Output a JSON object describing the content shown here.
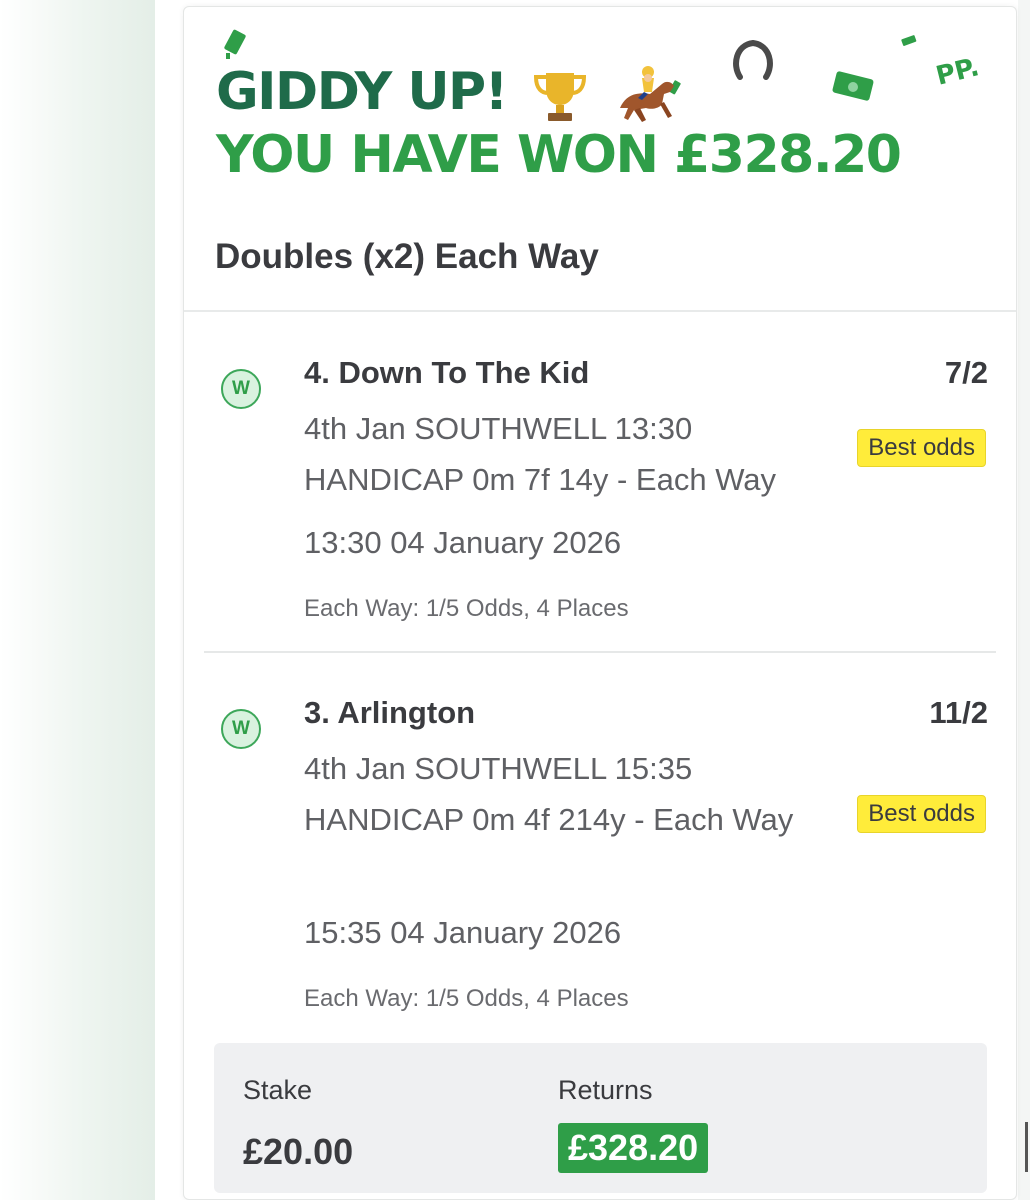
{
  "header": {
    "headline_1": "GIDDY UP!",
    "headline_2": "YOU HAVE WON £328.20",
    "bet_type": "Doubles (x2) Each Way",
    "logo_text": "PP.",
    "emojis": [
      "trophy-icon",
      "horse-racing-icon"
    ],
    "decorations": [
      "banknote-icon",
      "horseshoe-icon"
    ]
  },
  "selections": [
    {
      "result": "W",
      "runner": "4. Down To The Kid",
      "odds": "7/2",
      "description": "4th Jan SOUTHWELL 13:30 HANDICAP 0m 7f 14y - Each Way",
      "badge": "Best odds",
      "race_time": "13:30 04 January 2026",
      "each_way_terms": "Each Way: 1/5 Odds, 4 Places"
    },
    {
      "result": "W",
      "runner": "3. Arlington",
      "odds": "11/2",
      "description": "4th Jan SOUTHWELL 15:35 HANDICAP 0m 4f 214y - Each Way",
      "badge": "Best odds",
      "race_time": "15:35 04 January 2026",
      "each_way_terms": "Each Way: 1/5 Odds, 4 Places"
    }
  ],
  "summary": {
    "stake_label": "Stake",
    "stake_value": "£20.00",
    "returns_label": "Returns",
    "returns_value": "£328.20"
  },
  "colors": {
    "headline_dark_green": "#1f6b4a",
    "headline_green": "#2f9e48",
    "badge_yellow": "#ffec3a",
    "returns_green": "#2f9e48"
  }
}
